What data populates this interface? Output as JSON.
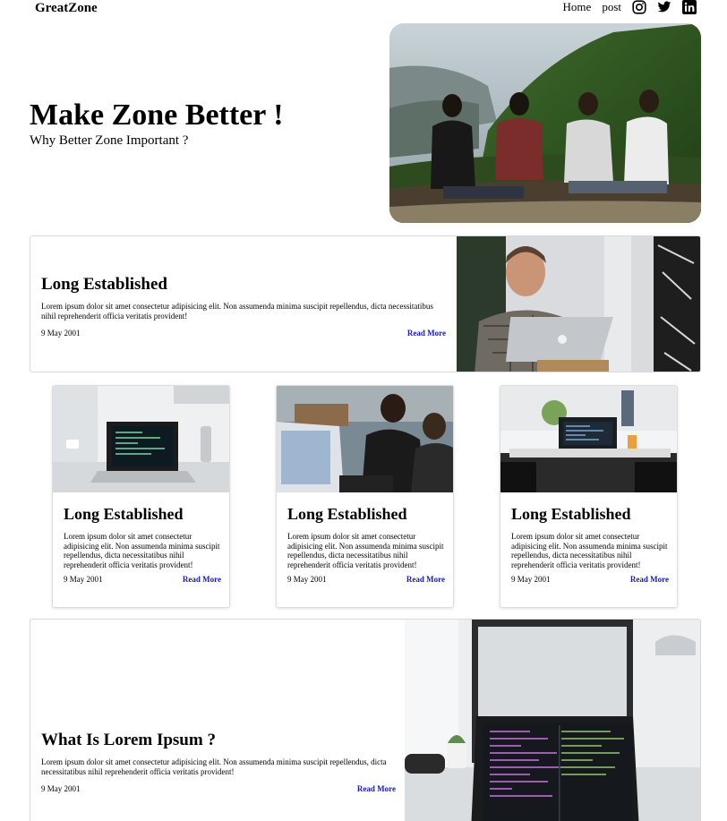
{
  "nav": {
    "brand": "GreatZone",
    "links": [
      "Home",
      "post"
    ],
    "icons": [
      "instagram-icon",
      "twitter-icon",
      "linkedin-icon"
    ]
  },
  "hero": {
    "title": "Make Zone Better !",
    "subtitle": "Why Better Zone Important ?",
    "image": "photo-friends-sitting-on-hill"
  },
  "featured": {
    "title": "Long Established",
    "body": "Lorem ipsum dolor sit amet consectetur adipisicing elit. Non assumenda minima suscipit repellendus, dicta necessitatibus nihil reprehenderit officia veritatis provident!",
    "date": "9 May 2001",
    "read_more": "Read More",
    "image": "photo-man-with-laptop"
  },
  "cards": [
    {
      "title": "Long Established",
      "body": "Lorem ipsum dolor sit amet consectetur adipisicing elit. Non assumenda minima suscipit repellendus, dicta necessitatibus nihil reprehenderit officia veritatis provident!",
      "date": "9 May 2001",
      "read_more": "Read More",
      "image": "photo-laptop-on-desk"
    },
    {
      "title": "Long Established",
      "body": "Lorem ipsum dolor sit amet consectetur adipisicing elit. Non assumenda minima suscipit repellendus, dicta necessitatibus nihil reprehenderit officia veritatis provident!",
      "date": "9 May 2001",
      "read_more": "Read More",
      "image": "photo-people-at-computers"
    },
    {
      "title": "Long Established",
      "body": "Lorem ipsum dolor sit amet consectetur adipisicing elit. Non assumenda minima suscipit repellendus, dicta necessitatibus nihil reprehenderit officia veritatis provident!",
      "date": "9 May 2001",
      "read_more": "Read More",
      "image": "photo-laptop-in-cafe"
    }
  ],
  "article": {
    "title": "What Is Lorem Ipsum ?",
    "body": "Lorem ipsum dolor sit amet consectetur adipisicing elit. Non assumenda minima suscipit repellendus, dicta necessitatibus nihil reprehenderit officia veritatis provident!",
    "date": "9 May 2001",
    "read_more": "Read More",
    "image": "photo-laptop-code-editor"
  },
  "colors": {
    "link": "#1a1abf",
    "border": "#d8d8d8"
  }
}
